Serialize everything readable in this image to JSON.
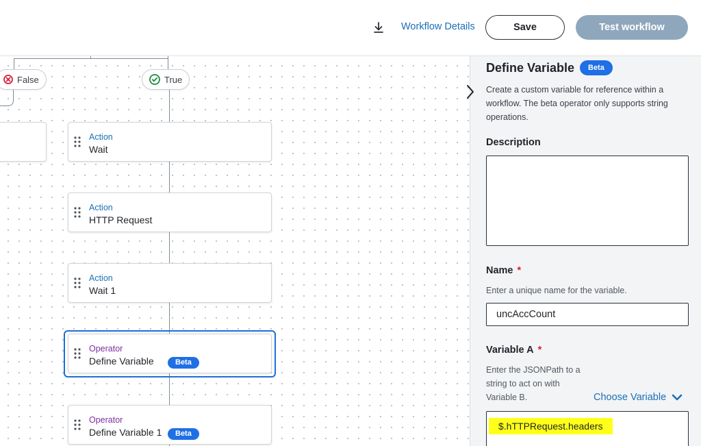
{
  "header": {
    "workflow_details": "Workflow Details",
    "save_label": "Save",
    "test_label": "Test workflow"
  },
  "canvas": {
    "branch_false": "False",
    "branch_true": "True",
    "nodes": [
      {
        "type": "Action",
        "label": "Wait"
      },
      {
        "type": "Action",
        "label": "HTTP Request"
      },
      {
        "type": "Action",
        "label": "Wait 1"
      },
      {
        "type": "Operator",
        "label": "Define Variable",
        "badge": "Beta"
      },
      {
        "type": "Operator",
        "label": "Define Variable 1",
        "badge": "Beta"
      }
    ]
  },
  "panel": {
    "title": "Define Variable",
    "badge": "Beta",
    "description": "Create a custom variable for reference within a workflow. The beta operator only supports string operations.",
    "description_label": "Description",
    "name_label": "Name",
    "name_help": "Enter a unique name for the variable.",
    "name_value": "uncAccCount",
    "variable_a_label": "Variable A",
    "variable_a_help": "Enter the JSONPath to a string to act on with Variable B.",
    "choose_variable": "Choose Variable",
    "variable_a_value": "$.hTTPRequest.headers",
    "required_mark": "*"
  },
  "colors": {
    "accent": "#1a6fb8",
    "beta_badge": "#1f6fe5",
    "test_button": "#8fa7bd",
    "selection": "#1a6fd6",
    "highlight": "#ffff1a"
  }
}
